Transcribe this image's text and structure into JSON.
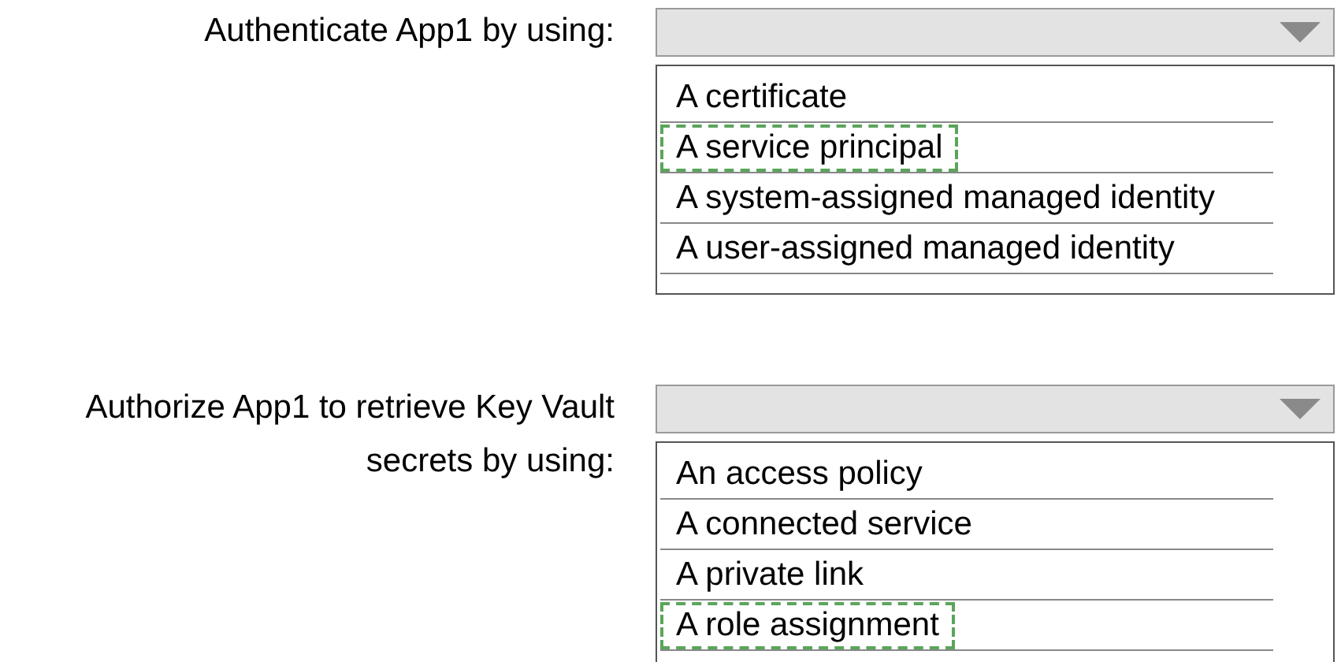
{
  "questions": [
    {
      "label_lines": [
        "Authenticate App1 by using:"
      ],
      "options": [
        {
          "text": "A certificate",
          "selected": false
        },
        {
          "text": "A service principal",
          "selected": true
        },
        {
          "text": "A system-assigned managed identity",
          "selected": false
        },
        {
          "text": "A user-assigned managed identity",
          "selected": false
        }
      ]
    },
    {
      "label_lines": [
        "Authorize App1 to retrieve Key Vault",
        "secrets by using:"
      ],
      "options": [
        {
          "text": "An access policy",
          "selected": false
        },
        {
          "text": "A connected service",
          "selected": false
        },
        {
          "text": "A private link",
          "selected": false
        },
        {
          "text": "A role assignment",
          "selected": true
        }
      ]
    }
  ]
}
